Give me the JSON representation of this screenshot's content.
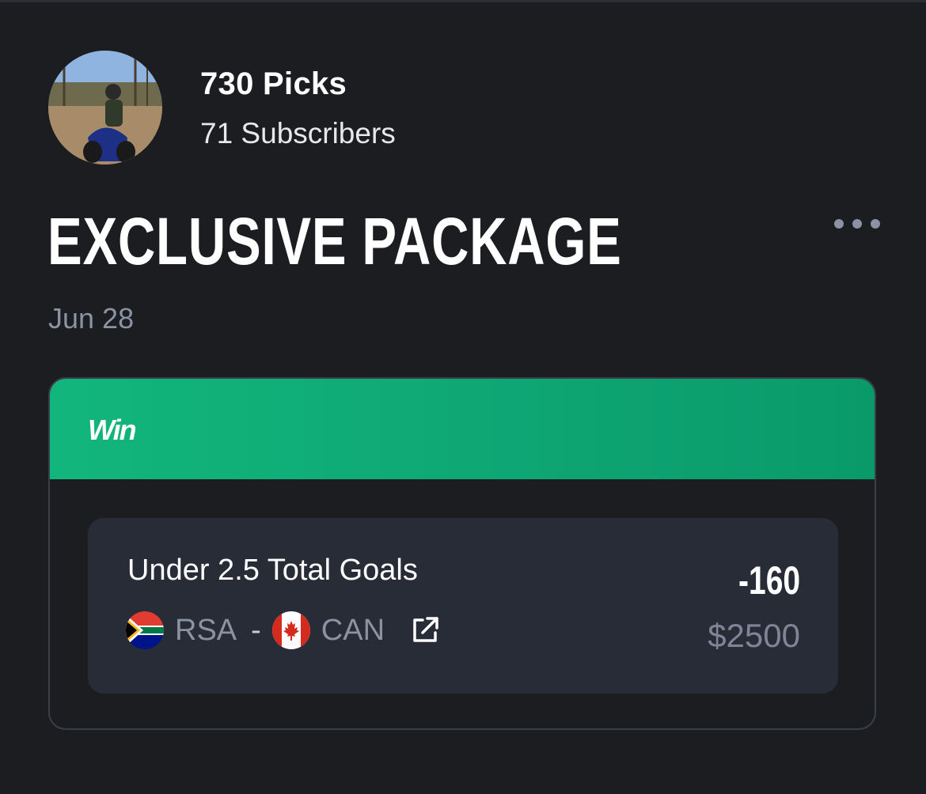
{
  "profile": {
    "picks_count": "730 Picks",
    "subscribers_count": "71 Subscribers"
  },
  "package": {
    "title": "EXCLUSIVE PACKAGE",
    "date": "Jun 28",
    "more_icon": "more-horizontal-icon"
  },
  "card": {
    "status_label": "Win",
    "status_color": "#12b67c",
    "pick": {
      "market": "Under 2.5 Total Goals",
      "home_team": "RSA",
      "separator": "-",
      "away_team": "CAN",
      "home_flag_icon": "south-africa-flag-icon",
      "away_flag_icon": "canada-flag-icon",
      "link_icon": "external-link-icon",
      "odds": "-160",
      "stake": "$2500"
    }
  }
}
